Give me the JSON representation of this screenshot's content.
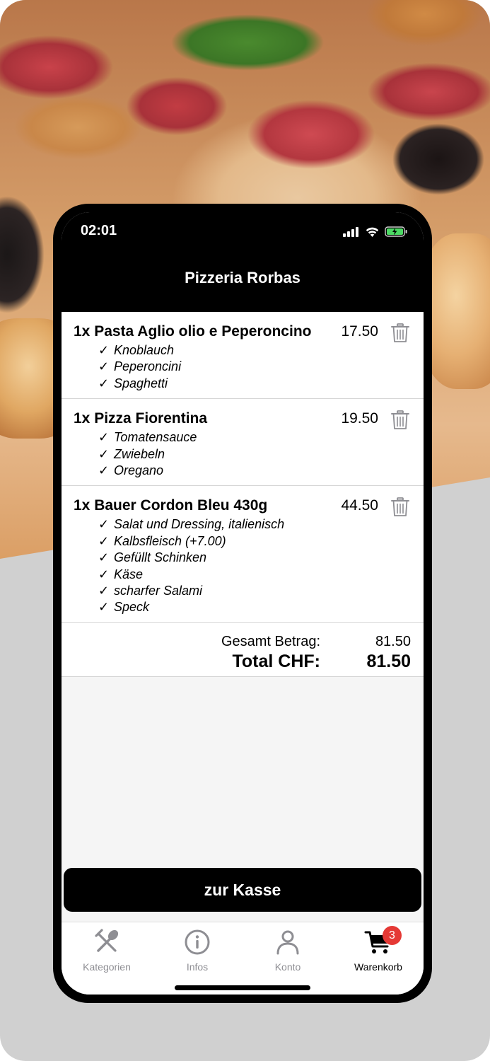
{
  "status_bar": {
    "time": "02:01"
  },
  "header": {
    "title": "Pizzeria Rorbas"
  },
  "cart": {
    "items": [
      {
        "title": "1x Pasta Aglio olio e Peperoncino",
        "price": "17.50",
        "options": [
          "Knoblauch",
          "Peperoncini",
          "Spaghetti"
        ]
      },
      {
        "title": "1x Pizza Fiorentina",
        "price": "19.50",
        "options": [
          "Tomatensauce",
          "Zwiebeln",
          "Oregano"
        ]
      },
      {
        "title": "1x Bauer Cordon Bleu  430g",
        "price": "44.50",
        "options": [
          "Salat und Dressing, italienisch",
          "Kalbsfleisch (+7.00)",
          "Gefüllt  Schinken",
          "Käse",
          "scharfer Salami",
          "Speck"
        ]
      }
    ],
    "check_mark": "✓",
    "subtotal_label": "Gesamt Betrag:",
    "subtotal_value": "81.50",
    "total_label": "Total CHF:",
    "total_value": "81.50"
  },
  "checkout_button": {
    "label": "zur Kasse"
  },
  "tabbar": {
    "tabs": [
      {
        "label": "Kategorien",
        "icon": "fork-spoon-icon",
        "active": false
      },
      {
        "label": "Infos",
        "icon": "info-icon",
        "active": false
      },
      {
        "label": "Konto",
        "icon": "user-icon",
        "active": false
      },
      {
        "label": "Warenkorb",
        "icon": "cart-icon",
        "active": true,
        "badge": "3"
      }
    ]
  },
  "colors": {
    "header_bg": "#000000",
    "badge": "#e53935",
    "inactive_tab": "#8e8e93",
    "battery": "#4cd964"
  }
}
